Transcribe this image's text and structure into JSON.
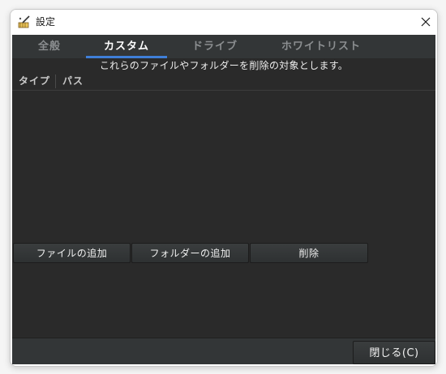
{
  "window": {
    "title": "設定",
    "close_symbol": "✕"
  },
  "tabs": [
    {
      "label": "全般",
      "active": false
    },
    {
      "label": "カスタム",
      "active": true
    },
    {
      "label": "ドライブ",
      "active": false
    },
    {
      "label": "ホワイトリスト",
      "active": false
    }
  ],
  "custom": {
    "description": "これらのファイルやフォルダーを削除の対象とします。",
    "columns": [
      "タイプ",
      "パス"
    ],
    "rows": [],
    "add_file_label": "ファイルの追加",
    "add_folder_label": "フォルダーの追加",
    "delete_label": "削除"
  },
  "footer": {
    "close_label": "閉じる(C)"
  },
  "colors": {
    "background": "#2a2a2a",
    "tabbar": "#333637",
    "accent": "#3f7fd8"
  }
}
